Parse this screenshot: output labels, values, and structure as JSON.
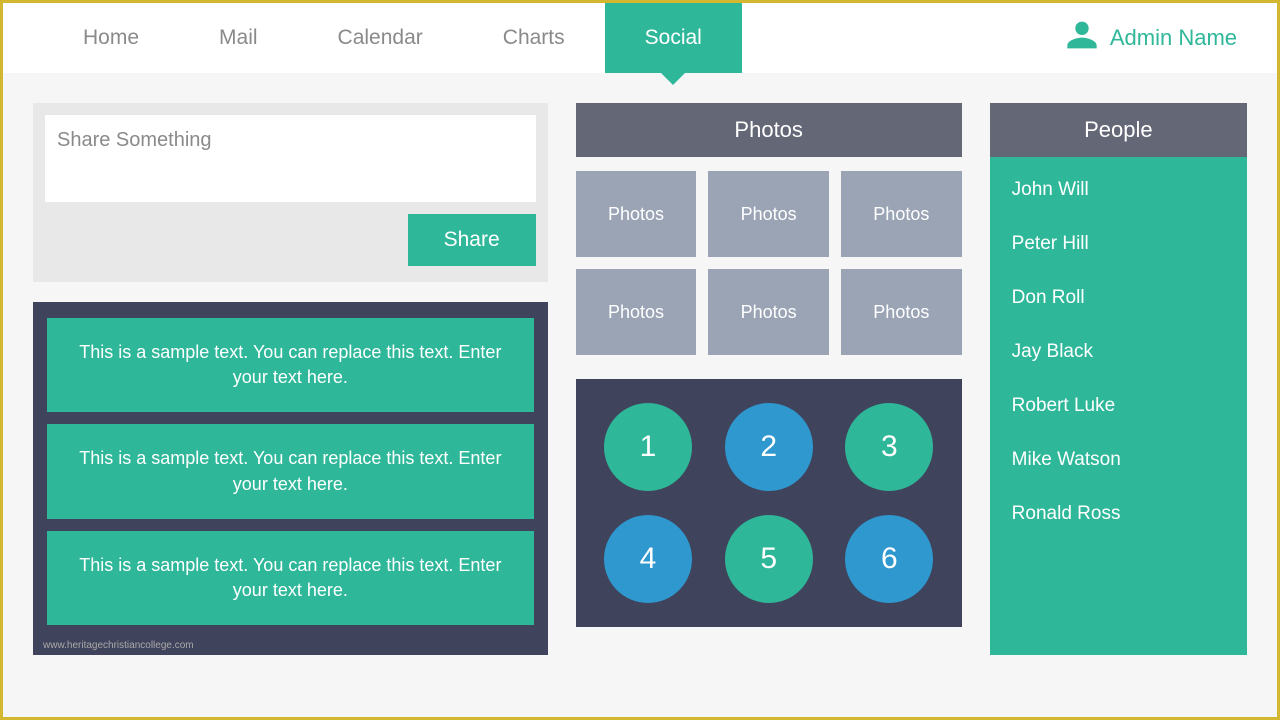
{
  "nav": {
    "items": [
      {
        "label": "Home",
        "active": false
      },
      {
        "label": "Mail",
        "active": false
      },
      {
        "label": "Calendar",
        "active": false
      },
      {
        "label": "Charts",
        "active": false
      },
      {
        "label": "Social",
        "active": true
      }
    ]
  },
  "user": {
    "name": "Admin Name"
  },
  "share": {
    "placeholder": "Share Something",
    "button_label": "Share"
  },
  "posts": [
    {
      "text": "This is a sample text. You can replace this text. Enter your text here."
    },
    {
      "text": "This is a sample text. You can replace this text. Enter your text here."
    },
    {
      "text": "This is a sample text. You can replace this text. Enter your text here."
    }
  ],
  "photos": {
    "title": "Photos",
    "cells": [
      "Photos",
      "Photos",
      "Photos",
      "Photos",
      "Photos",
      "Photos"
    ]
  },
  "numbers": {
    "items": [
      {
        "label": "1",
        "color": "green"
      },
      {
        "label": "2",
        "color": "blue"
      },
      {
        "label": "3",
        "color": "green"
      },
      {
        "label": "4",
        "color": "blue"
      },
      {
        "label": "5",
        "color": "green"
      },
      {
        "label": "6",
        "color": "blue"
      }
    ]
  },
  "people": {
    "title": "People",
    "items": [
      "John Will",
      "Peter Hill",
      "Don Roll",
      "Jay Black",
      "Robert Luke",
      "Mike Watson",
      "Ronald Ross"
    ]
  },
  "watermark": "www.heritagechristiancollege.com",
  "colors": {
    "accent": "#2fb79a",
    "blue": "#2f98cf",
    "dark": "#3f435b",
    "header": "#646876",
    "muted": "#9aa4b5"
  }
}
